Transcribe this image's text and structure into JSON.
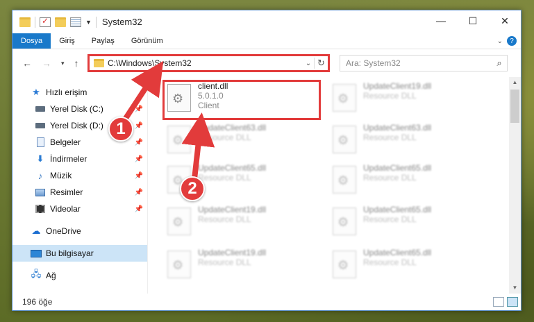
{
  "window": {
    "title": "System32",
    "controls": {
      "minimize": "—",
      "maximize": "☐",
      "close": "✕"
    }
  },
  "ribbon": {
    "tabs": [
      {
        "label": "Dosya",
        "active": true
      },
      {
        "label": "Giriş",
        "active": false
      },
      {
        "label": "Paylaş",
        "active": false
      },
      {
        "label": "Görünüm",
        "active": false
      }
    ],
    "help_label": "?"
  },
  "address": {
    "path": "C:\\Windows\\System32",
    "search_placeholder": "Ara: System32"
  },
  "sidebar": {
    "items": [
      {
        "label": "Hızlı erişim",
        "icon": "star-icon",
        "pinned": false
      },
      {
        "label": "Yerel Disk (C:)",
        "icon": "drive-icon",
        "pinned": true
      },
      {
        "label": "Yerel Disk (D:)",
        "icon": "drive-icon",
        "pinned": true
      },
      {
        "label": "Belgeler",
        "icon": "documents-icon",
        "pinned": true
      },
      {
        "label": "İndirmeler",
        "icon": "download-icon",
        "pinned": true
      },
      {
        "label": "Müzik",
        "icon": "music-icon",
        "pinned": true
      },
      {
        "label": "Resimler",
        "icon": "pictures-icon",
        "pinned": true
      },
      {
        "label": "Videolar",
        "icon": "videos-icon",
        "pinned": true
      },
      {
        "label": "OneDrive",
        "icon": "cloud-icon",
        "pinned": false
      },
      {
        "label": "Bu bilgisayar",
        "icon": "computer-icon",
        "pinned": false,
        "selected": true
      },
      {
        "label": "Ağ",
        "icon": "network-icon",
        "pinned": false
      }
    ]
  },
  "files": [
    {
      "name": "client.dll",
      "line2": "5.0.1.0",
      "line3": "Client",
      "highlighted": true
    },
    {
      "name": "UpdateClient19.dll",
      "line2": "Resource DLL",
      "line3": ""
    },
    {
      "name": "UpdateClient63.dll",
      "line2": "Resource DLL",
      "line3": ""
    },
    {
      "name": "UpdateClient63.dll",
      "line2": "Resource DLL",
      "line3": ""
    },
    {
      "name": "UpdateClient65.dll",
      "line2": "Resource DLL",
      "line3": ""
    },
    {
      "name": "UpdateClient65.dll",
      "line2": "Resource DLL",
      "line3": ""
    },
    {
      "name": "UpdateClient19.dll",
      "line2": "Resource DLL",
      "line3": ""
    },
    {
      "name": "UpdateClient65.dll",
      "line2": "Resource DLL",
      "line3": ""
    },
    {
      "name": "UpdateClient19.dll",
      "line2": "Resource DLL",
      "line3": ""
    },
    {
      "name": "UpdateClient65.dll",
      "line2": "Resource DLL",
      "line3": ""
    }
  ],
  "status": {
    "item_count": "196 öğe"
  },
  "annotations": {
    "marker1": "1",
    "marker2": "2",
    "color": "#e23b3b"
  }
}
